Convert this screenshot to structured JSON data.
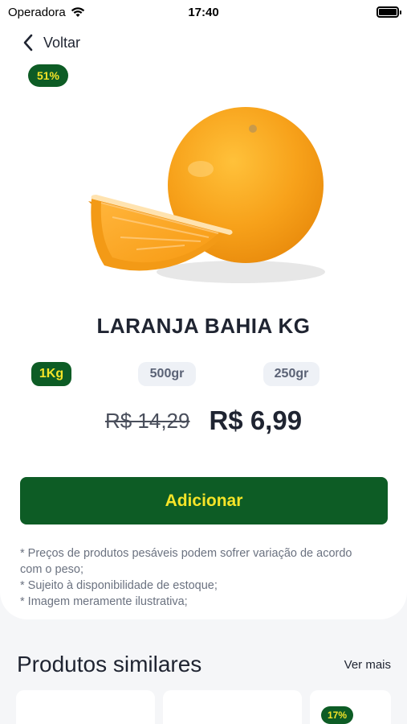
{
  "status_bar": {
    "carrier": "Operadora",
    "time": "17:40"
  },
  "nav": {
    "back_label": "Voltar"
  },
  "product": {
    "discount": "51%",
    "name": "LARANJA BAHIA KG",
    "weights": [
      {
        "label": "1Kg",
        "selected": true
      },
      {
        "label": "500gr",
        "selected": false
      },
      {
        "label": "250gr",
        "selected": false
      }
    ],
    "old_price": "R$ 14,29",
    "price": "R$ 6,99",
    "add_label": "Adicionar",
    "notes": [
      "* Preços de produtos pesáveis podem sofrer variação de acordo com o peso;",
      "* Sujeito à disponibilidade de estoque;",
      "* Imagem meramente ilustrativa;"
    ]
  },
  "similar": {
    "title": "Produtos similares",
    "see_more": "Ver mais",
    "items": [
      {
        "discount": ""
      },
      {
        "discount": ""
      },
      {
        "discount": "17%"
      }
    ]
  },
  "colors": {
    "brand_green": "#0d5c25",
    "brand_yellow": "#f5e428",
    "orange": "#f7a11a"
  }
}
